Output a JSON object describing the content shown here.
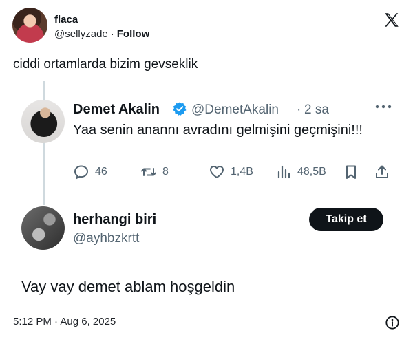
{
  "tweet": {
    "author_name": "flaca",
    "author_handle": "@sellyzade",
    "separator": "·",
    "follow_label": "Follow",
    "text": "ciddi ortamlarda bizim gevseklik",
    "timestamp": "5:12 PM · Aug 6, 2025"
  },
  "quoted": {
    "original": {
      "name": "Demet Akalin",
      "handle": "@DemetAkalin",
      "separator": "·",
      "time": "2 sa",
      "text": "Yaa senin anannı avradını gelmişini geçmişini!!!",
      "replies": "46",
      "retweets": "8",
      "likes": "1,4B",
      "views": "48,5B"
    },
    "reply": {
      "name": "herhangi biri",
      "handle": "@ayhbzkrtt",
      "follow_label": "Takip et",
      "text": "Vay vay demet ablam hoşgeldin"
    }
  },
  "icons": {
    "brand": "x-logo",
    "verified": "verified-badge-icon",
    "more": "more-icon",
    "reply": "reply-icon",
    "retweet": "retweet-icon",
    "like": "heart-icon",
    "views": "views-icon",
    "bookmark": "bookmark-icon",
    "share": "share-icon",
    "info": "info-icon"
  },
  "colors": {
    "text": "#0f1419",
    "muted": "#536471",
    "verified": "#1d9bf0",
    "thread_line": "#cfd9de",
    "button": "#0f1419"
  }
}
